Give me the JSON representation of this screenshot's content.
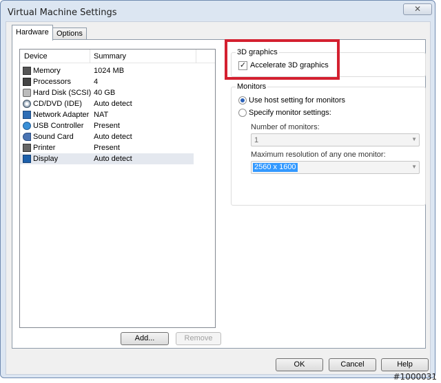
{
  "window": {
    "title": "Virtual Machine Settings",
    "close_glyph": "✕"
  },
  "tabs": [
    {
      "label": "Hardware",
      "active": true
    },
    {
      "label": "Options",
      "active": false
    }
  ],
  "device_list": {
    "headers": {
      "device": "Device",
      "summary": "Summary"
    },
    "rows": [
      {
        "icon": "memory-icon",
        "device": "Memory",
        "summary": "1024 MB"
      },
      {
        "icon": "processor-icon",
        "device": "Processors",
        "summary": "4"
      },
      {
        "icon": "hard-disk-icon",
        "device": "Hard Disk (SCSI)",
        "summary": "40 GB"
      },
      {
        "icon": "cd-dvd-icon",
        "device": "CD/DVD (IDE)",
        "summary": "Auto detect"
      },
      {
        "icon": "network-adapter-icon",
        "device": "Network Adapter",
        "summary": "NAT"
      },
      {
        "icon": "usb-icon",
        "device": "USB Controller",
        "summary": "Present"
      },
      {
        "icon": "sound-card-icon",
        "device": "Sound Card",
        "summary": "Auto detect"
      },
      {
        "icon": "printer-icon",
        "device": "Printer",
        "summary": "Present"
      },
      {
        "icon": "display-icon",
        "device": "Display",
        "summary": "Auto detect",
        "selected": true
      }
    ],
    "add_label": "Add...",
    "remove_label": "Remove"
  },
  "graphics_3d": {
    "title": "3D graphics",
    "accelerate_label": "Accelerate 3D graphics",
    "accelerate_checked": true,
    "check_glyph": "✓"
  },
  "monitors": {
    "title": "Monitors",
    "use_host_label": "Use host setting for monitors",
    "use_host_selected": true,
    "specify_label": "Specify monitor settings:",
    "number_label": "Number of monitors:",
    "number_value": "1",
    "max_res_label": "Maximum resolution of any one monitor:",
    "max_res_value": "2560 x 1600",
    "dropdown_glyph": "▼"
  },
  "footer": {
    "ok_label": "OK",
    "cancel_label": "Cancel",
    "help_label": "Help"
  },
  "watermark": "#1000031",
  "colors": {
    "highlight_border": "#d42030",
    "selection_blue": "#3399ff"
  }
}
